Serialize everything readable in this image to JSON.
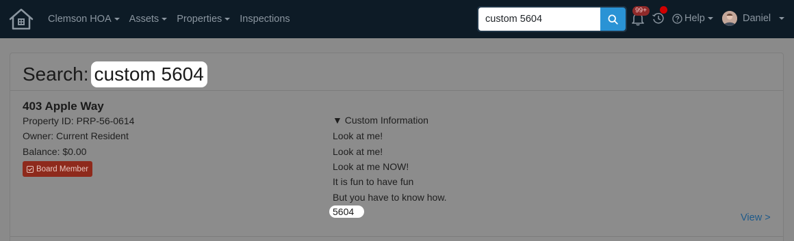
{
  "navbar": {
    "logo_icon": "house-logo-icon",
    "links": [
      {
        "label": "Clemson HOA",
        "dropdown": true
      },
      {
        "label": "Assets",
        "dropdown": true
      },
      {
        "label": "Properties",
        "dropdown": true
      },
      {
        "label": "Inspections",
        "dropdown": false
      }
    ],
    "search": {
      "value": "custom 5604",
      "button_icon": "search-icon"
    },
    "notifications": {
      "icon": "bell-icon",
      "badge": "99+"
    },
    "history": {
      "icon": "history-icon",
      "has_indicator": true
    },
    "help": {
      "label": "Help",
      "icon": "question-circle-icon"
    },
    "user": {
      "name": "Daniel",
      "icon": "avatar"
    }
  },
  "page": {
    "title_prefix": "Search:",
    "query": "custom 5604"
  },
  "result": {
    "title": "403 Apple Way",
    "details": [
      "Property ID: PRP-56-0614",
      "Owner: Current Resident",
      "Balance: $0.00"
    ],
    "badge": {
      "label": "Board Member",
      "icon": "check-square-icon",
      "color": "#8e2a1c"
    },
    "custom_info": {
      "heading": "▼ Custom Information",
      "lines": [
        "Look at me!",
        "Look at me!",
        "Look at me NOW!",
        "It is fun to have fun",
        "But you have to know how."
      ],
      "match": "5604"
    },
    "view_link": "View >"
  },
  "colors": {
    "navbar_bg": "#0d1b26",
    "search_button": "#2a93d5",
    "overlay": "#8a8a8a",
    "link": "#1e5a8a"
  }
}
